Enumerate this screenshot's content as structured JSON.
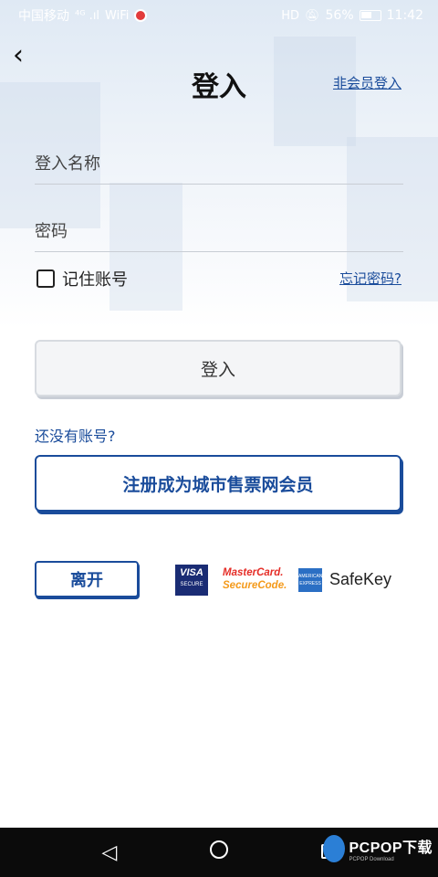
{
  "status_bar": {
    "carrier": "中国移动",
    "signal": "⁴ᴳ .ıl",
    "wifi": "WiFi",
    "hd": "HD",
    "battery_percent": "56%",
    "time": "11:42"
  },
  "header": {
    "back_icon": "‹",
    "title": "登入",
    "guest_login": "非会员登入"
  },
  "form": {
    "username_placeholder": "登入名称",
    "password_placeholder": "密码",
    "remember_label": "记住账号",
    "forgot_link": "忘记密码?"
  },
  "actions": {
    "login_label": "登入",
    "no_account_text": "还没有账号?",
    "register_label": "注册成为城市售票网会员",
    "leave_label": "离开"
  },
  "payment_logos": {
    "visa_line1": "VISA",
    "visa_line2": "SECURE",
    "mastercard_line1": "MasterCard.",
    "mastercard_line2": "SecureCode.",
    "amex_line1": "AMERICAN",
    "amex_line2": "EXPRESS",
    "safekey": "SafeKey"
  },
  "watermark": {
    "text": "PCPOP下载",
    "sub": "PCPOP Download"
  },
  "colors": {
    "accent": "#1a4c9b",
    "nav_bar": "#0b0b0b"
  }
}
